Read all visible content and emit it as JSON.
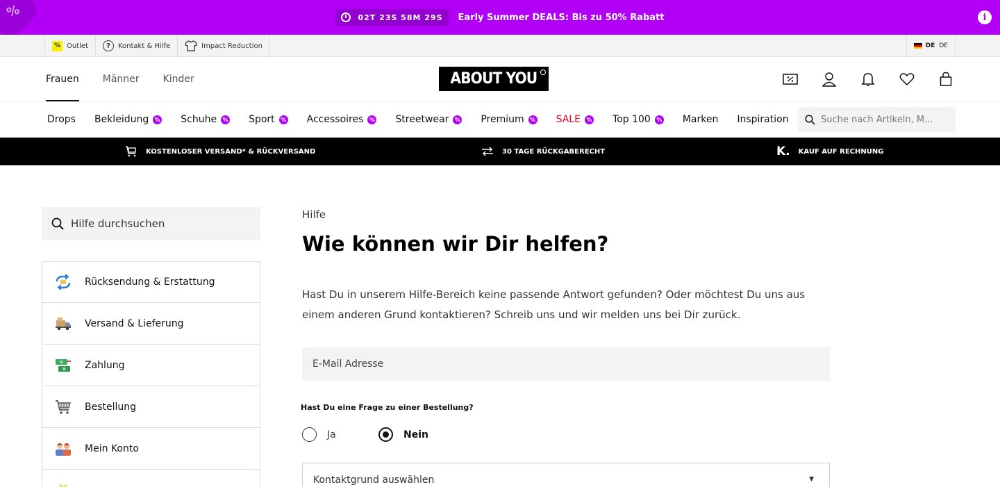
{
  "promo": {
    "timer": "02T 23S 58M 29S",
    "text": "Early Summer DEALS: Bis zu 50% Rabatt",
    "corner_glyph": "%",
    "info_glyph": "i",
    "bg_color": "#b100f5"
  },
  "utility": {
    "items": [
      {
        "label": "Outlet",
        "icon": "percent-tag-icon",
        "glyph": "%"
      },
      {
        "label": "Kontakt & Hilfe",
        "icon": "question-circle-icon",
        "glyph": "?"
      },
      {
        "label": "Impact Reduction",
        "icon": "tshirt-icon"
      }
    ],
    "language": {
      "country": "DE",
      "lang": "DE"
    }
  },
  "header": {
    "gender_tabs": [
      "Frauen",
      "Männer",
      "Kinder"
    ],
    "active_tab": "Frauen",
    "logo_text": "ABOUT YOU"
  },
  "categories": {
    "items": [
      {
        "label": "Drops",
        "badge": false
      },
      {
        "label": "Bekleidung",
        "badge": true
      },
      {
        "label": "Schuhe",
        "badge": true
      },
      {
        "label": "Sport",
        "badge": true
      },
      {
        "label": "Accessoires",
        "badge": true
      },
      {
        "label": "Streetwear",
        "badge": true
      },
      {
        "label": "Premium",
        "badge": true
      },
      {
        "label": "SALE",
        "badge": true
      },
      {
        "label": "Top 100",
        "badge": true
      },
      {
        "label": "Marken",
        "badge": false
      },
      {
        "label": "Inspiration",
        "badge": false
      }
    ],
    "badge_glyph": "%",
    "search_placeholder": "Suche nach Artikeln, M..."
  },
  "benefits": [
    {
      "label": "KOSTENLOSER VERSAND* & RÜCKVERSAND",
      "icon": "cart-icon"
    },
    {
      "label": "30 TAGE RÜCKGABERECHT",
      "icon": "exchange-arrows-icon"
    },
    {
      "label": "KAUF AUF RECHNUNG",
      "icon": "klarna-k-icon",
      "glyph": "K."
    }
  ],
  "sidebar": {
    "search_placeholder": "Hilfe durchsuchen",
    "items": [
      {
        "label": "Rücksendung & Erstattung",
        "icon": "return-arrows-icon"
      },
      {
        "label": "Versand & Lieferung",
        "icon": "delivery-truck-icon"
      },
      {
        "label": "Zahlung",
        "icon": "money-icon"
      },
      {
        "label": "Bestellung",
        "icon": "shopping-cart-icon"
      },
      {
        "label": "Mein Konto",
        "icon": "people-icon"
      },
      {
        "label": "",
        "icon": "gift-icon"
      }
    ]
  },
  "content": {
    "breadcrumb": "Hilfe",
    "title": "Wie können wir Dir helfen?",
    "intro": "Hast Du in unserem Hilfe-Bereich keine passende Antwort gefunden? Oder möchtest Du uns aus einem anderen Grund kontaktieren? Schreib uns und wir melden uns bei Dir zurück.",
    "email_placeholder": "E-Mail Adresse",
    "question": "Hast Du eine Frage zu einer Bestellung?",
    "radio_yes": "Ja",
    "radio_no": "Nein",
    "selected": "Nein",
    "select_placeholder": "Kontaktgrund auswählen",
    "select_arrow": "▼"
  },
  "colors": {
    "accent": "#b100f5",
    "sale": "#e3002b",
    "benefits_bg": "#000000"
  }
}
